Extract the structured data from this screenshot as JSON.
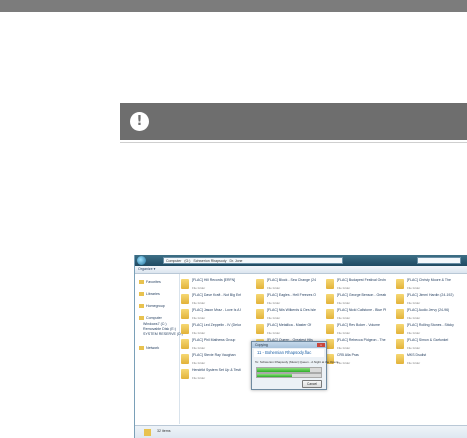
{
  "note": {
    "icon": "exclamation-icon",
    "symbol": "!"
  },
  "explorer": {
    "breadcrumb": [
      "Computer",
      "(G:)",
      "Schwerion Rhapsody",
      "Dr. Jone"
    ],
    "search_placeholder": "",
    "toolbar": {
      "organize": "Organize ▾"
    },
    "nav": [
      "Favorites",
      "Libraries",
      "Homegroup",
      "Computer",
      "Windows7 (C:)",
      "Removable Disk (E:)",
      "SYSTEM RESERVE (D:)",
      "Network"
    ],
    "folders": [
      {
        "name": "[FLAC] Hill Records [ERFN]",
        "type": "File folder"
      },
      {
        "name": "[FLAC] Block - Sea Change (24-96)",
        "type": "File folder"
      },
      {
        "name": "[FLAC] Budapest Festival Orchestra",
        "type": "File folder"
      },
      {
        "name": "[FLAC] Christy Moore & The",
        "type": "File folder"
      },
      {
        "name": "[FLAC] Dave Kraft - Not Big Enf",
        "type": "File folder"
      },
      {
        "name": "[FLAC] Eagles - Hell Freezes Over",
        "type": "File folder"
      },
      {
        "name": "[FLAC] George Benson - Greatest",
        "type": "File folder"
      },
      {
        "name": "[FLAC] Jimmi Hardin (24-192)",
        "type": "File folder"
      },
      {
        "name": "[FLAC] Jason Mraz - Love Is A Four",
        "type": "File folder"
      },
      {
        "name": "[FLAC] Nils Wilkerds & Des Isles",
        "type": "File folder"
      },
      {
        "name": "[FLAC] Nicki Callstone - Blue Planet",
        "type": "File folder"
      },
      {
        "name": "[FLAC] Audio Jervy (24-96)",
        "type": "File folder"
      },
      {
        "name": "[FLAC] Led Zeppelin - IV (Deluxe)",
        "type": "File folder"
      },
      {
        "name": "[FLAC] Metallica - Master Of",
        "type": "File folder"
      },
      {
        "name": "[FLAC] Rev Boker - Volume",
        "type": "File folder"
      },
      {
        "name": "[FLAC] Rolling Stones - Sticky",
        "type": "File folder"
      },
      {
        "name": "[FLAC] Phil Mathews Group",
        "type": "File folder"
      },
      {
        "name": "[FLAC] Queen - Greatest Hits",
        "type": "File folder"
      },
      {
        "name": "[FLAC] Rebecca Pidgeon - The",
        "type": "File folder"
      },
      {
        "name": "[FLAC] Simon & Garfunkel",
        "type": "File folder"
      },
      {
        "name": "[FLAC] Stevie Ray Vaughan",
        "type": "File folder"
      },
      {
        "name": "CR5 Bob Marley Music (HD)",
        "type": "File folder"
      },
      {
        "name": "CR5 Alla Pras",
        "type": "File folder"
      },
      {
        "name": "MKS Dsulist",
        "type": "File folder"
      },
      {
        "name": "Hendrikt System Set Up & Testing",
        "type": "File folder"
      },
      {
        "name": "Queen - A Night at the Opera",
        "type": "File folder"
      }
    ],
    "status": "32 items"
  },
  "dialog": {
    "title": "Copying",
    "close": "x",
    "heading": "11 - Bohemian Rhapsody.flac",
    "subtext": "To: Schwerion Rhapsody (Music) Queen - A Night at the Opera",
    "progress": 0.83,
    "progress2": 0.55,
    "cancel": "Cancel"
  }
}
